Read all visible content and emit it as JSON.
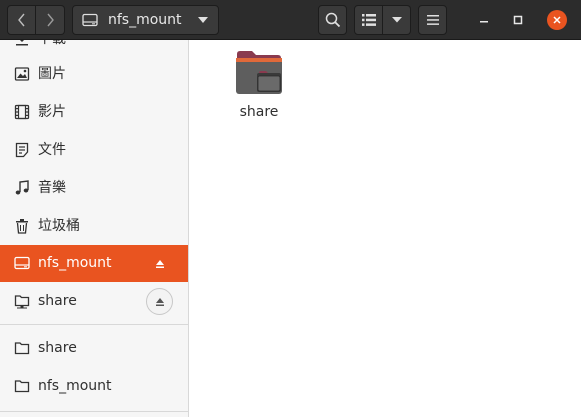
{
  "header": {
    "path_label": "nfs_mount"
  },
  "sidebar": {
    "items": [
      {
        "label": "下載"
      },
      {
        "label": "圖片"
      },
      {
        "label": "影片"
      },
      {
        "label": "文件"
      },
      {
        "label": "音樂"
      },
      {
        "label": "垃圾桶"
      },
      {
        "label": "nfs_mount"
      },
      {
        "label": "share"
      },
      {
        "label": "share"
      },
      {
        "label": "nfs_mount"
      }
    ]
  },
  "main": {
    "files": [
      {
        "name": "share"
      }
    ]
  },
  "colors": {
    "accent": "#e95420",
    "headerbar": "#2c2c2c",
    "sidebar_bg": "#f6f6f6"
  }
}
